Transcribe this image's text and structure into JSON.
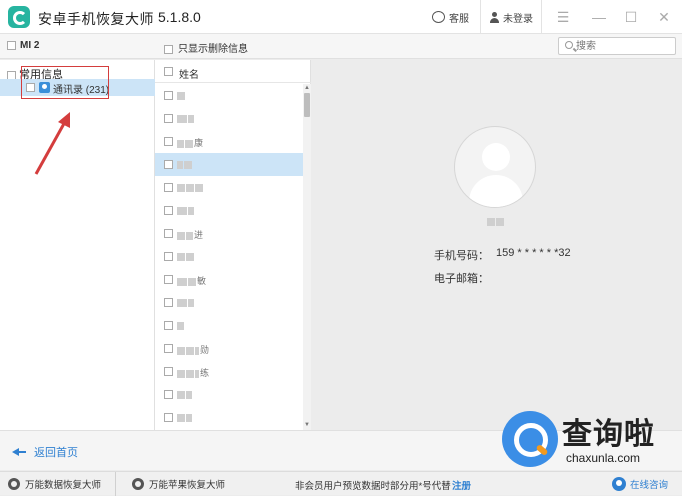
{
  "titlebar": {
    "app_title": "安卓手机恢复大师",
    "version": "5.1.8.0",
    "support_label": "客服",
    "login_label": "未登录"
  },
  "toolbar": {
    "device_name": "MI 2",
    "only_deleted_label": "只显示删除信息",
    "search_placeholder": "搜索"
  },
  "left": {
    "category_label": "常用信息",
    "contacts_label": "通讯录 (231)"
  },
  "list": {
    "header_label": "姓名",
    "rows": [
      {
        "suffix": "",
        "selected": false
      },
      {
        "suffix": "",
        "selected": false
      },
      {
        "suffix": "康",
        "selected": false
      },
      {
        "suffix": "",
        "selected": true
      },
      {
        "suffix": "",
        "selected": false
      },
      {
        "suffix": "",
        "selected": false
      },
      {
        "suffix": "进",
        "selected": false
      },
      {
        "suffix": "",
        "selected": false
      },
      {
        "suffix": "敏",
        "selected": false
      },
      {
        "suffix": "",
        "selected": false
      },
      {
        "suffix": "",
        "selected": false
      },
      {
        "suffix": "勋",
        "selected": false
      },
      {
        "suffix": "练",
        "selected": false
      },
      {
        "suffix": "",
        "selected": false
      },
      {
        "suffix": "",
        "selected": false
      }
    ]
  },
  "detail": {
    "phone_label": "手机号码：",
    "phone_value": "159 * * * * * *32",
    "email_label": "电子邮箱："
  },
  "footer": {
    "back_label": "返回首页",
    "tool_a": "万能数据恢复大师",
    "tool_b": "万能苹果恢复大师",
    "note": "非会员用户预览数据时部分用*号代替",
    "register": "注册",
    "online": "在线咨询"
  },
  "watermark": {
    "title": "查询啦",
    "url": "chaxunla.com"
  },
  "colors": {
    "accent": "#2f80d1",
    "selection": "#cce4f7",
    "annotation_red": "#d43d3d",
    "brand_teal": "#27b4a0"
  }
}
